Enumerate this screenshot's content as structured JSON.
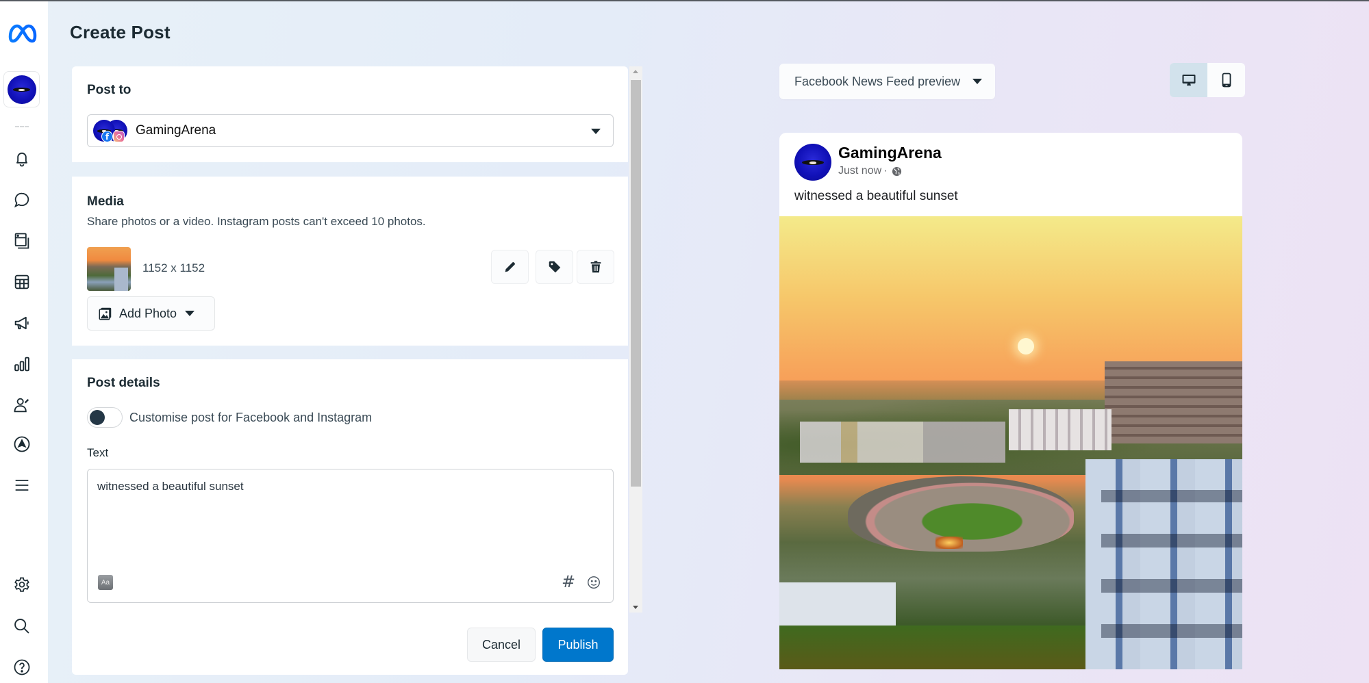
{
  "page": {
    "title": "Create Post"
  },
  "sidebar": {
    "logo": "meta-logo",
    "account_avatar": "GamingArena",
    "items": [
      {
        "name": "notifications",
        "icon": "bell-icon"
      },
      {
        "name": "inbox",
        "icon": "chat-bubble-icon"
      },
      {
        "name": "content",
        "icon": "content-pages-icon"
      },
      {
        "name": "planner",
        "icon": "calendar-grid-icon"
      },
      {
        "name": "ads",
        "icon": "megaphone-icon"
      },
      {
        "name": "insights",
        "icon": "bar-chart-icon"
      },
      {
        "name": "audience",
        "icon": "person-edit-icon"
      },
      {
        "name": "boost",
        "icon": "navigation-arrow-icon"
      },
      {
        "name": "all-tools",
        "icon": "menu-icon"
      }
    ],
    "bottom_items": [
      {
        "name": "settings",
        "icon": "gear-icon"
      },
      {
        "name": "search",
        "icon": "search-icon"
      },
      {
        "name": "help",
        "icon": "help-icon"
      }
    ]
  },
  "post_to": {
    "title": "Post to",
    "selected": "GamingArena",
    "platforms": [
      "Facebook",
      "Instagram"
    ]
  },
  "media": {
    "title": "Media",
    "description": "Share photos or a video. Instagram posts can't exceed 10 photos.",
    "items": [
      {
        "dimensions": "1152 x 1152"
      }
    ],
    "actions": [
      "edit",
      "tag",
      "delete"
    ],
    "add_photo_label": "Add Photo"
  },
  "post_details": {
    "title": "Post details",
    "customise_toggle": {
      "label": "Customise post for Facebook and Instagram",
      "on": false
    },
    "text_label": "Text",
    "text_value": "witnessed a beautiful sunset"
  },
  "footer": {
    "cancel_label": "Cancel",
    "publish_label": "Publish"
  },
  "preview": {
    "placement": "Facebook News Feed preview",
    "device": {
      "options": [
        "desktop",
        "mobile"
      ],
      "selected": "desktop"
    },
    "post": {
      "page_name": "GamingArena",
      "timestamp": "Just now",
      "separator": "·",
      "audience": "public",
      "text": "witnessed a beautiful sunset"
    }
  },
  "colors": {
    "publish_button": "#0077cc",
    "meta_blue": "#0866ff",
    "device_active": "#d2e2ec"
  }
}
